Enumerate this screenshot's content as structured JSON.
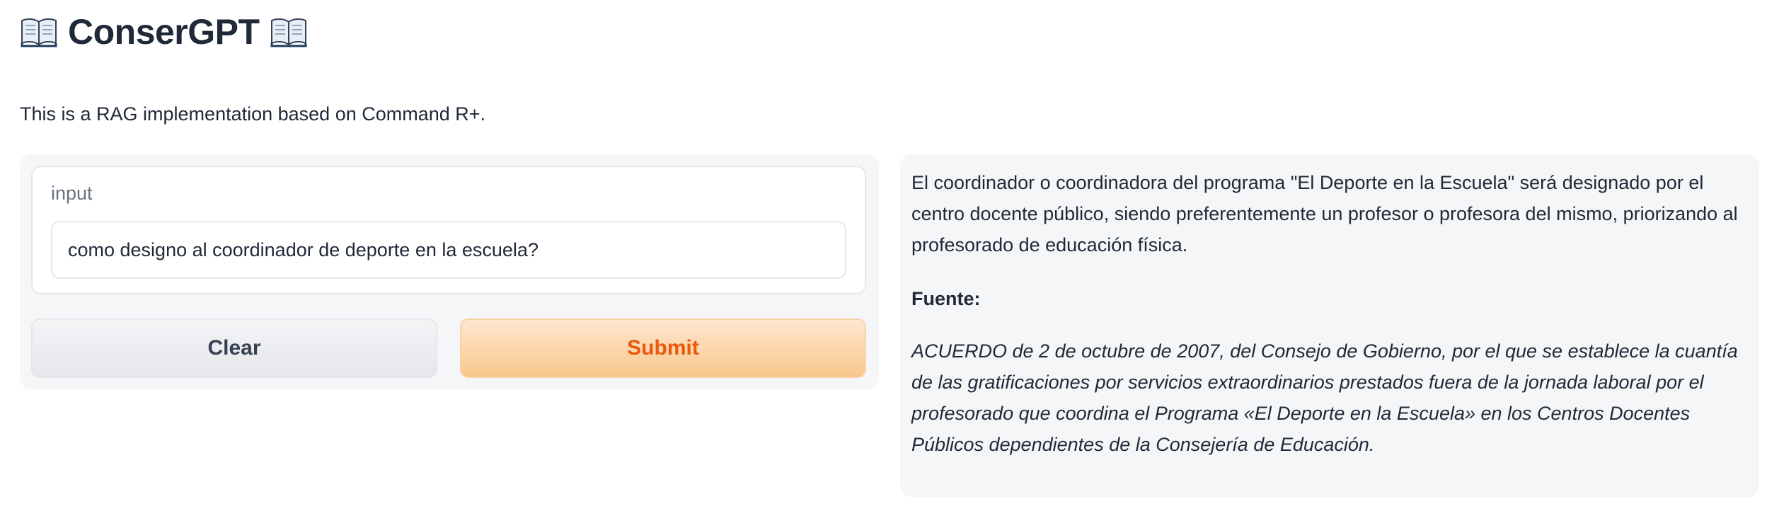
{
  "header": {
    "title": "ConserGPT",
    "left_icon": "open-book-icon",
    "right_icon": "open-book-icon"
  },
  "description": "This is a RAG implementation based on Command R+.",
  "input": {
    "label": "input",
    "value": "como designo al coordinador de deporte en la escuela?"
  },
  "buttons": {
    "clear_label": "Clear",
    "submit_label": "Submit"
  },
  "output": {
    "answer": "El coordinador o coordinadora del programa \"El Deporte en la Escuela\" será designado por el centro docente público, siendo preferentemente un profesor o profesora del mismo, priorizando al profesorado de educación física.",
    "source_label": "Fuente:",
    "source_text": "ACUERDO de 2 de octubre de 2007, del Consejo de Gobierno, por el que se establece la cuantía de las gratificaciones por servicios extraordinarios prestados fuera de la jornada laboral por el profesorado que coordina el Programa «El Deporte en la Escuela» en los Centros Docentes Públicos dependientes de la Consejería de Educación."
  },
  "colors": {
    "submit_text": "#ea580c",
    "submit_bg": "#f9c78c",
    "panel_bg": "#f5f6f8"
  }
}
